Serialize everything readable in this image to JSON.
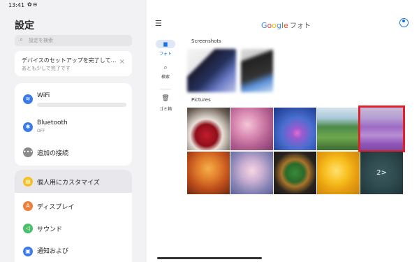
{
  "status": {
    "time": "13:41",
    "icons": "✿⊖",
    "right": "⌔ ▭",
    "dots": "•••"
  },
  "settings": {
    "title": "設定",
    "search_placeholder": "設定を検索",
    "setup_card": {
      "line1": "デバイスのセットアップを完了して…",
      "line2": "あとも少しで完了です",
      "close": "×"
    },
    "items": [
      {
        "label": "WiFi",
        "sub": "",
        "color": "#3b7be8",
        "icon": "wifi-icon"
      },
      {
        "label": "Bluetooth",
        "sub": "OFF",
        "color": "#3b7be8",
        "icon": "bluetooth-icon"
      },
      {
        "label": "追加の接続",
        "sub": "",
        "color": "#8a8a8a",
        "icon": "more-icon"
      },
      {
        "label": "個人用にカスタマイズ",
        "sub": "",
        "color": "#f4c020",
        "icon": "palette-icon"
      },
      {
        "label": "ディスプレイ",
        "sub": "",
        "color": "#f07e3a",
        "icon": "display-icon"
      },
      {
        "label": "サウンド",
        "sub": "",
        "color": "#4cbf6a",
        "icon": "sound-icon"
      },
      {
        "label": "通知および",
        "sub": "",
        "color": "#3b7be8",
        "icon": "notification-icon"
      }
    ]
  },
  "photos": {
    "brand": {
      "g": "G",
      "o1": "o",
      "o2": "o",
      "g2": "g",
      "l": "l",
      "e": "e",
      "suffix": "フォト"
    },
    "rail": {
      "photos": "フォト",
      "search": "検索",
      "trash": "ゴミ箱"
    },
    "sections": {
      "screenshots": "Screenshots",
      "pictures": "Pictures"
    },
    "more_count": "2>"
  }
}
